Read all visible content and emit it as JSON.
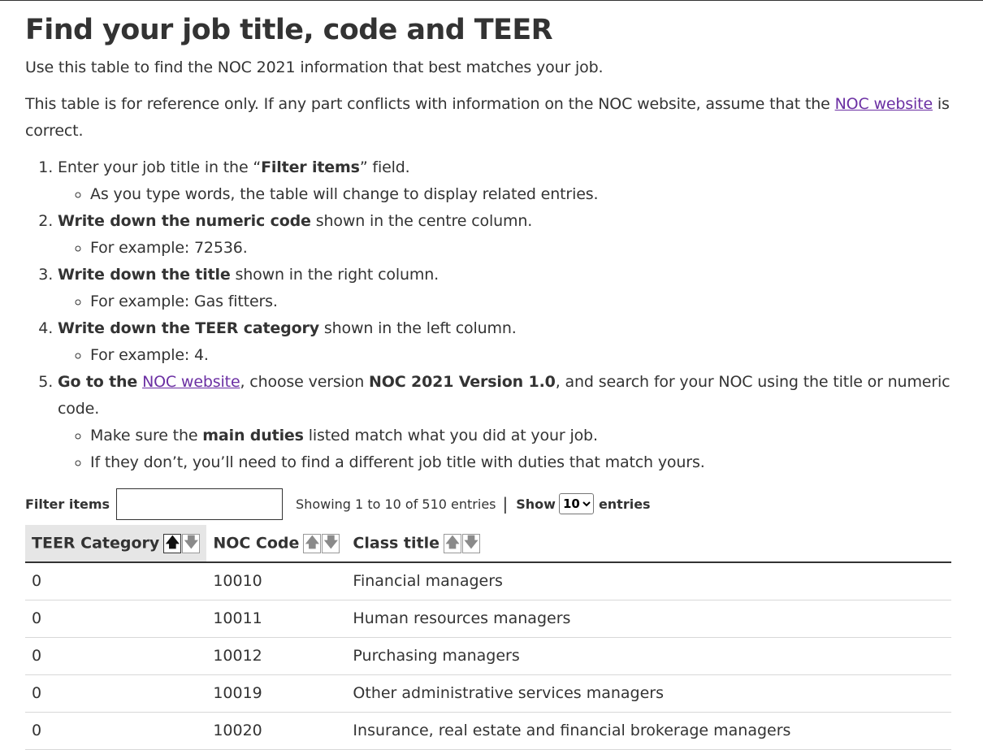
{
  "page": {
    "title": "Find your job title, code and TEER",
    "intro": "Use this table to find the NOC 2021 information that best matches your job.",
    "disclaimer_before": "This table is for reference only. If any part conflicts with information on the NOC website, assume that the ",
    "disclaimer_link": "NOC website",
    "disclaimer_after": " is correct."
  },
  "steps": {
    "s1": {
      "a": "Enter your job title in the “",
      "b": "Filter items",
      "c": "” field.",
      "sub1": "As you type words, the table will change to display related entries."
    },
    "s2": {
      "b": "Write down the numeric code",
      "c": " shown in the centre column.",
      "sub1": "For example: 72536."
    },
    "s3": {
      "b": "Write down the title",
      "c": " shown in the right column.",
      "sub1": "For example: Gas fitters."
    },
    "s4": {
      "b": "Write down the TEER category",
      "c": " shown in the left column.",
      "sub1": "For example: 4."
    },
    "s5": {
      "b1": "Go to the",
      "space": " ",
      "link": "NOC website",
      "c1": ", choose version ",
      "b2": "NOC 2021 Version 1.0",
      "c2": ", and search for your NOC using the title or numeric code.",
      "sub1_a": "Make sure the ",
      "sub1_b": "main duties",
      "sub1_c": " listed match what you did at your job.",
      "sub2": "If they don’t, you’ll need to find a different job title with duties that match yours."
    }
  },
  "controls": {
    "filter_label": "Filter items",
    "filter_value": "",
    "info": "Showing 1 to 10 of 510 entries",
    "separator": "|",
    "show_label": "Show",
    "show_value": "10",
    "entries_label": "entries"
  },
  "icons": {
    "sort_asc": "arrow-up-icon",
    "sort_desc": "arrow-down-icon",
    "select": "chevron-down-icon"
  },
  "table": {
    "headers": [
      "TEER Category",
      "NOC Code",
      "Class title"
    ],
    "rows": [
      [
        "0",
        "10010",
        "Financial managers"
      ],
      [
        "0",
        "10011",
        "Human resources managers"
      ],
      [
        "0",
        "10012",
        "Purchasing managers"
      ],
      [
        "0",
        "10019",
        "Other administrative services managers"
      ],
      [
        "0",
        "10020",
        "Insurance, real estate and financial brokerage managers"
      ]
    ]
  },
  "colors": {
    "text": "#333333",
    "link": "#6b2fa3",
    "active_header_bg": "#e6e6e6"
  }
}
